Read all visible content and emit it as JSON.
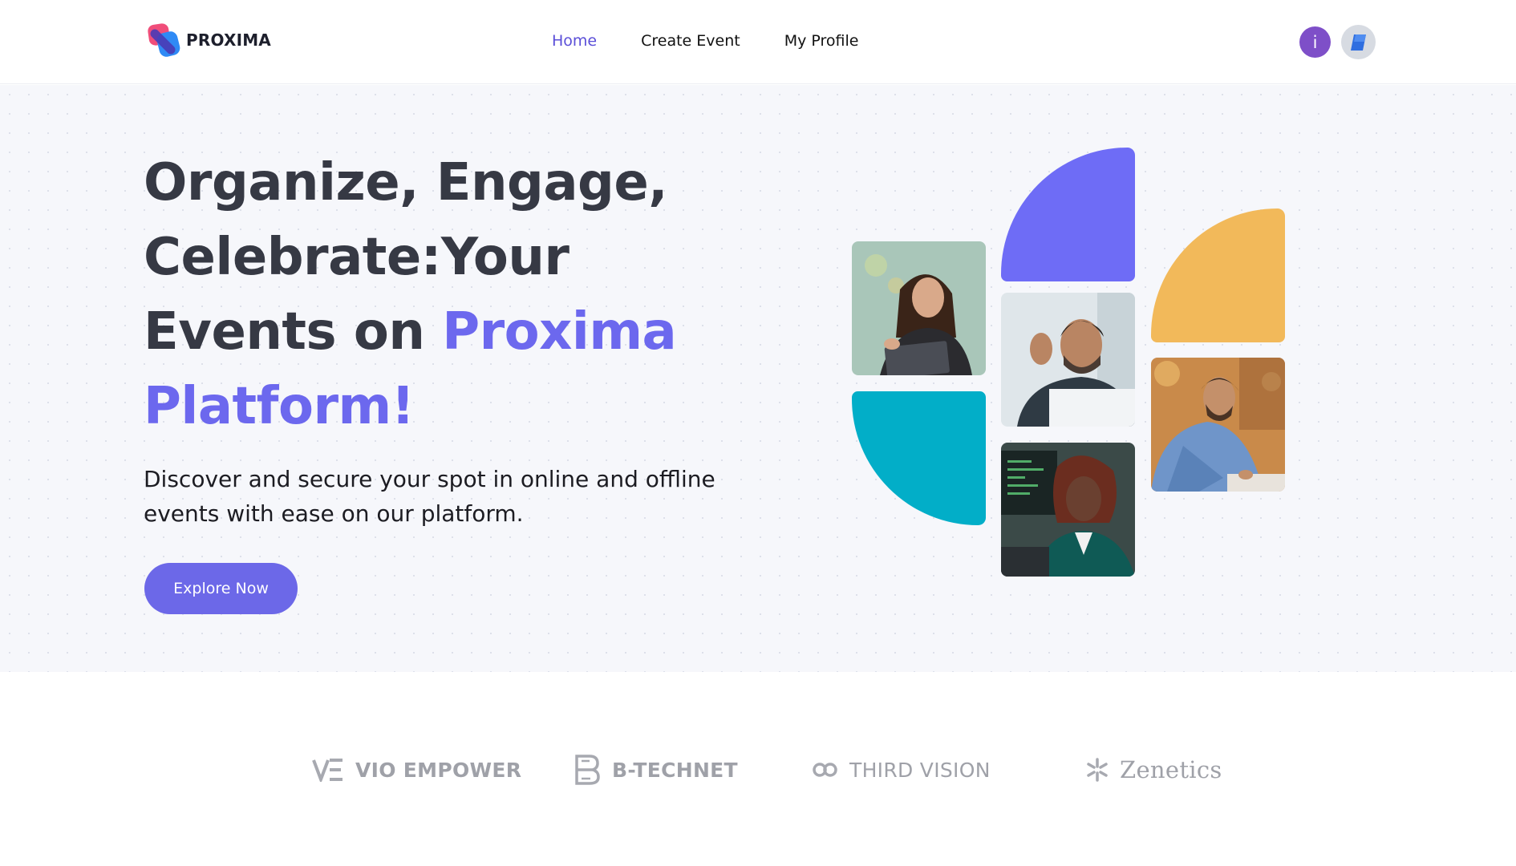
{
  "brand": {
    "name": "PROXIMA"
  },
  "nav": {
    "items": [
      {
        "label": "Home",
        "active": true
      },
      {
        "label": "Create Event",
        "active": false
      },
      {
        "label": "My Profile",
        "active": false
      }
    ]
  },
  "user": {
    "initial": "i"
  },
  "hero": {
    "title_line1": "Organize, Engage,",
    "title_line2": "Celebrate:Your",
    "title_line3_plain": "Events on ",
    "title_line3_accent": "Proxima",
    "title_line4_accent": "Platform!",
    "subtitle": "Discover and secure your spot in online and offline events with ease on our platform.",
    "cta_label": "Explore Now"
  },
  "partners": [
    {
      "name": "VIO EMPOWER",
      "icon": "ve-monogram-icon"
    },
    {
      "name": "B-TECHNET",
      "icon": "b-monogram-icon"
    },
    {
      "name": "THIRD VISION",
      "icon": "infinity-icon"
    },
    {
      "name": "Zenetics",
      "icon": "asterisk-icon"
    }
  ],
  "colors": {
    "accent": "#6c68ee",
    "button": "#6c68e8",
    "avatar": "#7e4fc8",
    "shape_purple": "#6e6cf6",
    "shape_yellow": "#f2b95a",
    "shape_teal": "#02aec8",
    "hero_bg": "#f6f7fb"
  }
}
